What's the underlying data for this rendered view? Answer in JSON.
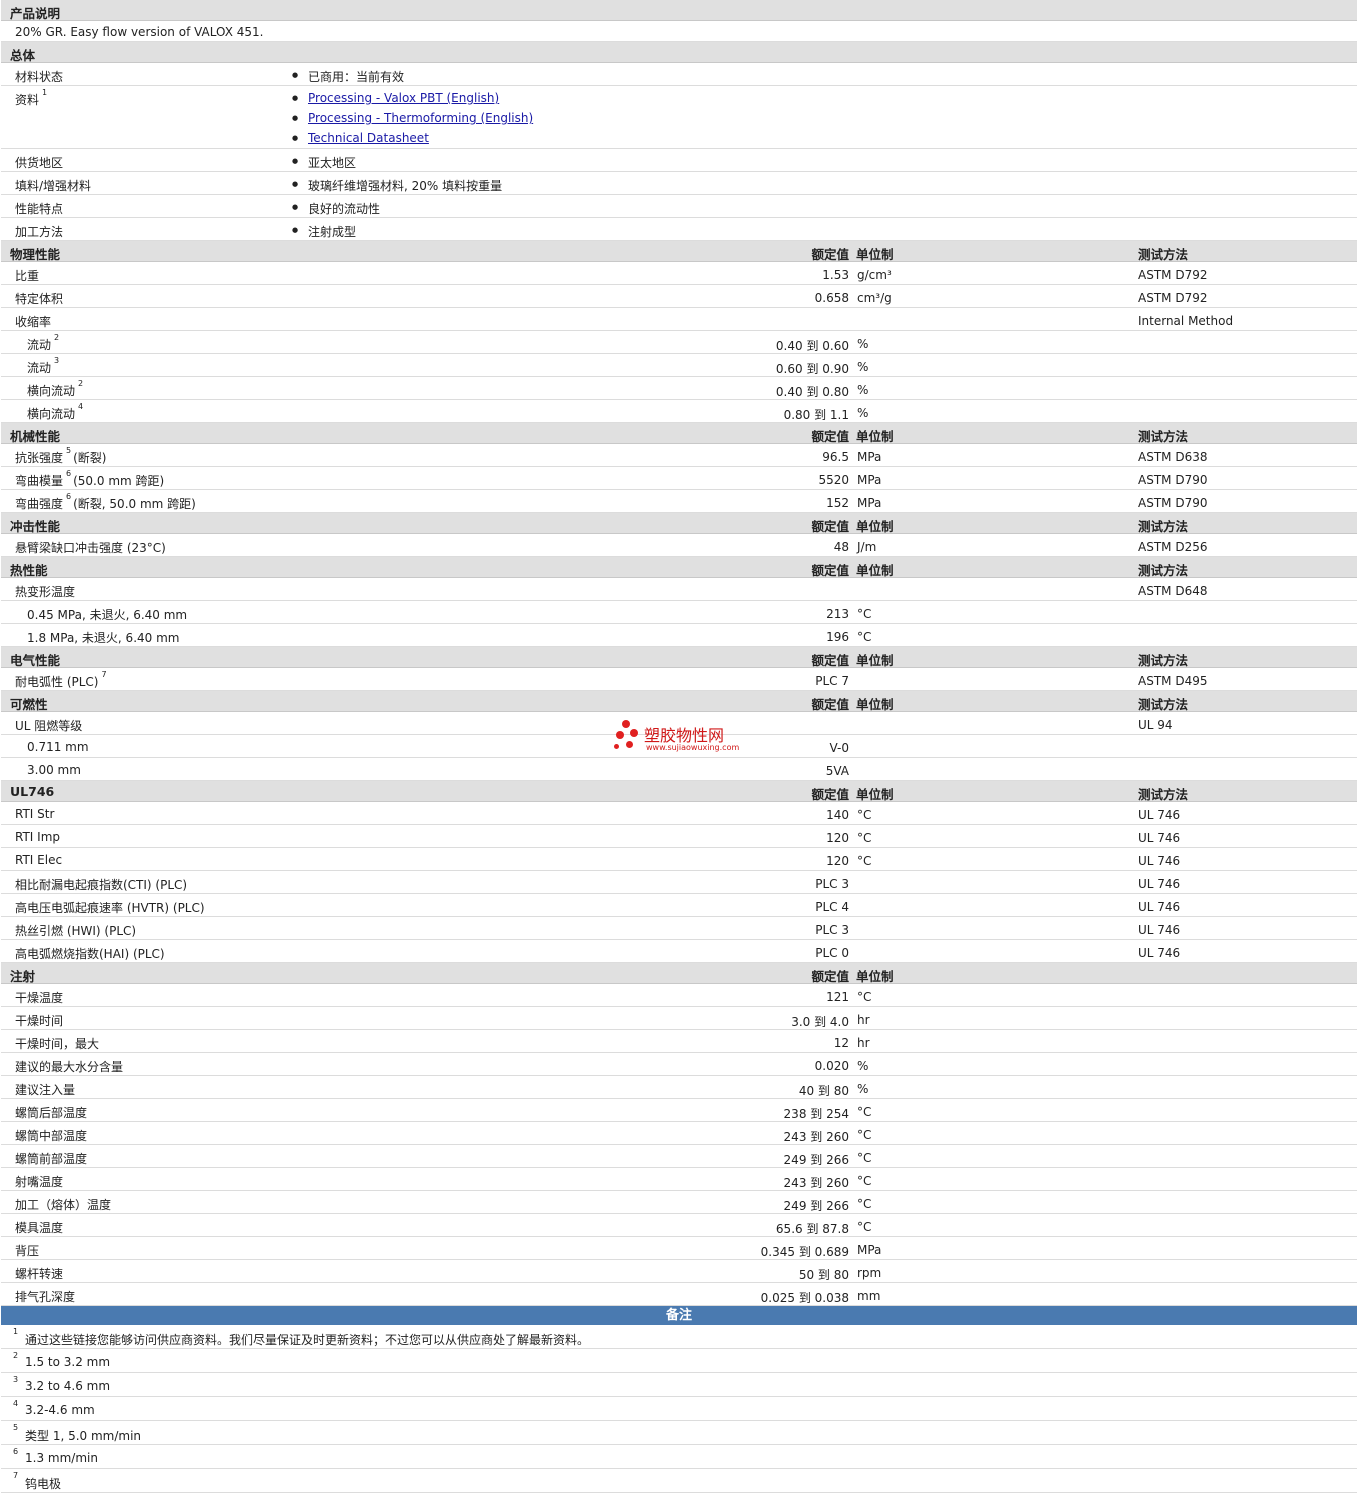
{
  "desc": {
    "title": "产品说明",
    "text": "20% GR. Easy flow version of VALOX 451."
  },
  "general": {
    "title": "总体",
    "rows": [
      {
        "label": "材料状态",
        "items": [
          "已商用：当前有效"
        ]
      },
      {
        "label": "资料",
        "sup": "1",
        "links": [
          "Processing - Valox PBT (English)",
          "Processing - Thermoforming (English)",
          "Technical Datasheet"
        ]
      },
      {
        "label": "供货地区",
        "items": [
          "亚太地区"
        ]
      },
      {
        "label": "填料/增强材料",
        "items": [
          "玻璃纤维增强材料, 20% 填料按重量"
        ]
      },
      {
        "label": "性能特点",
        "items": [
          "良好的流动性"
        ]
      },
      {
        "label": "加工方法",
        "items": [
          "注射成型"
        ]
      }
    ]
  },
  "headers": {
    "value": "额定值",
    "unit": "单位制",
    "method": "测试方法"
  },
  "sections": [
    {
      "title": "物理性能",
      "show_method": true,
      "rows": [
        {
          "label": "比重",
          "value": "1.53",
          "unit": "g/cm³",
          "method": "ASTM D792"
        },
        {
          "label": "特定体积",
          "value": "0.658",
          "unit": "cm³/g",
          "method": "ASTM D792"
        },
        {
          "label": "收缩率",
          "value": "",
          "unit": "",
          "method": "Internal Method"
        },
        {
          "label": "流动",
          "sub": true,
          "sup": "2",
          "value": "0.40 到  0.60",
          "unit": "%",
          "method": ""
        },
        {
          "label": "流动",
          "sub": true,
          "sup": "3",
          "value": "0.60 到  0.90",
          "unit": "%",
          "method": ""
        },
        {
          "label": "横向流动",
          "sub": true,
          "sup": "2",
          "value": "0.40 到  0.80",
          "unit": "%",
          "method": ""
        },
        {
          "label": "横向流动",
          "sub": true,
          "sup": "4",
          "value": "0.80 到  1.1",
          "unit": "%",
          "method": ""
        }
      ]
    },
    {
      "title": "机械性能",
      "show_method": true,
      "rows": [
        {
          "label": "抗张强度",
          "sup": "5",
          "suffix": "(断裂)",
          "value": "96.5",
          "unit": "MPa",
          "method": "ASTM D638"
        },
        {
          "label": "弯曲模量",
          "sup": "6",
          "suffix": "(50.0 mm 跨距)",
          "value": "5520",
          "unit": "MPa",
          "method": "ASTM D790"
        },
        {
          "label": "弯曲强度",
          "sup": "6",
          "suffix": "(断裂, 50.0 mm 跨距)",
          "value": "152",
          "unit": "MPa",
          "method": "ASTM D790"
        }
      ]
    },
    {
      "title": "冲击性能",
      "show_method": true,
      "rows": [
        {
          "label": "悬臂梁缺口冲击强度  (23°C)",
          "value": "48",
          "unit": "J/m",
          "method": "ASTM D256"
        }
      ]
    },
    {
      "title": "热性能",
      "show_method": true,
      "rows": [
        {
          "label": "热变形温度",
          "value": "",
          "unit": "",
          "method": "ASTM D648"
        },
        {
          "label": "0.45 MPa, 未退火, 6.40 mm",
          "sub": true,
          "value": "213",
          "unit": "°C",
          "method": ""
        },
        {
          "label": "1.8 MPa, 未退火, 6.40 mm",
          "sub": true,
          "value": "196",
          "unit": "°C",
          "method": ""
        }
      ]
    },
    {
      "title": "电气性能",
      "show_method": true,
      "rows": [
        {
          "label": "耐电弧性  (PLC)",
          "sup": "7",
          "value": "PLC 7",
          "unit": "",
          "method": "ASTM D495"
        }
      ]
    },
    {
      "title": "可燃性",
      "show_method": true,
      "rows": [
        {
          "label": "UL 阻燃等级",
          "value": "",
          "unit": "",
          "method": "UL 94"
        },
        {
          "label": "0.711 mm",
          "sub": true,
          "value": "V-0",
          "unit": "",
          "method": ""
        },
        {
          "label": "3.00 mm",
          "sub": true,
          "value": "5VA",
          "unit": "",
          "method": ""
        }
      ]
    },
    {
      "title": "UL746",
      "show_method": true,
      "rows": [
        {
          "label": "RTI Str",
          "value": "140",
          "unit": "°C",
          "method": "UL 746"
        },
        {
          "label": "RTI Imp",
          "value": "120",
          "unit": "°C",
          "method": "UL 746"
        },
        {
          "label": "RTI Elec",
          "value": "120",
          "unit": "°C",
          "method": "UL 746"
        },
        {
          "label": "相比耐漏电起痕指数(CTI) (PLC)",
          "value": "PLC 3",
          "unit": "",
          "method": "UL 746"
        },
        {
          "label": "高电压电弧起痕速率  (HVTR) (PLC)",
          "value": "PLC 4",
          "unit": "",
          "method": "UL 746"
        },
        {
          "label": "热丝引燃  (HWI) (PLC)",
          "value": "PLC 3",
          "unit": "",
          "method": "UL 746"
        },
        {
          "label": "高电弧燃烧指数(HAI) (PLC)",
          "value": "PLC 0",
          "unit": "",
          "method": "UL 746"
        }
      ]
    },
    {
      "title": "注射",
      "show_method": false,
      "rows": [
        {
          "label": "干燥温度",
          "value": "121",
          "unit": "°C",
          "method": ""
        },
        {
          "label": "干燥时间",
          "value": "3.0 到  4.0",
          "unit": "hr",
          "method": ""
        },
        {
          "label": "干燥时间，最大",
          "value": "12",
          "unit": "hr",
          "method": ""
        },
        {
          "label": "建议的最大水分含量",
          "value": "0.020",
          "unit": "%",
          "method": ""
        },
        {
          "label": "建议注入量",
          "value": "40 到  80",
          "unit": "%",
          "method": ""
        },
        {
          "label": "螺筒后部温度",
          "value": "238 到  254",
          "unit": "°C",
          "method": ""
        },
        {
          "label": "螺筒中部温度",
          "value": "243 到  260",
          "unit": "°C",
          "method": ""
        },
        {
          "label": "螺筒前部温度",
          "value": "249 到  266",
          "unit": "°C",
          "method": ""
        },
        {
          "label": "射嘴温度",
          "value": "243 到  260",
          "unit": "°C",
          "method": ""
        },
        {
          "label": "加工（熔体）温度",
          "value": "249 到  266",
          "unit": "°C",
          "method": ""
        },
        {
          "label": "模具温度",
          "value": "65.6 到  87.8",
          "unit": "°C",
          "method": ""
        },
        {
          "label": "背压",
          "value": "0.345 到  0.689",
          "unit": "MPa",
          "method": ""
        },
        {
          "label": "螺杆转速",
          "value": "50 到  80",
          "unit": "rpm",
          "method": ""
        },
        {
          "label": "排气孔深度",
          "value": "0.025 到  0.038",
          "unit": "mm",
          "method": ""
        }
      ]
    }
  ],
  "notes": {
    "title": "备注",
    "items": [
      {
        "n": "1",
        "text": "通过这些链接您能够访问供应商资料。我们尽量保证及时更新资料；不过您可以从供应商处了解最新资料。"
      },
      {
        "n": "2",
        "text": "1.5 to 3.2 mm"
      },
      {
        "n": "3",
        "text": "3.2 to 4.6 mm"
      },
      {
        "n": "4",
        "text": "3.2-4.6 mm"
      },
      {
        "n": "5",
        "text": "类型  1, 5.0 mm/min"
      },
      {
        "n": "6",
        "text": "1.3 mm/min"
      },
      {
        "n": "7",
        "text": "钨电极"
      }
    ]
  },
  "watermark": {
    "brand": "塑胶物性网",
    "url": "www.sujiaowuxing.com"
  }
}
